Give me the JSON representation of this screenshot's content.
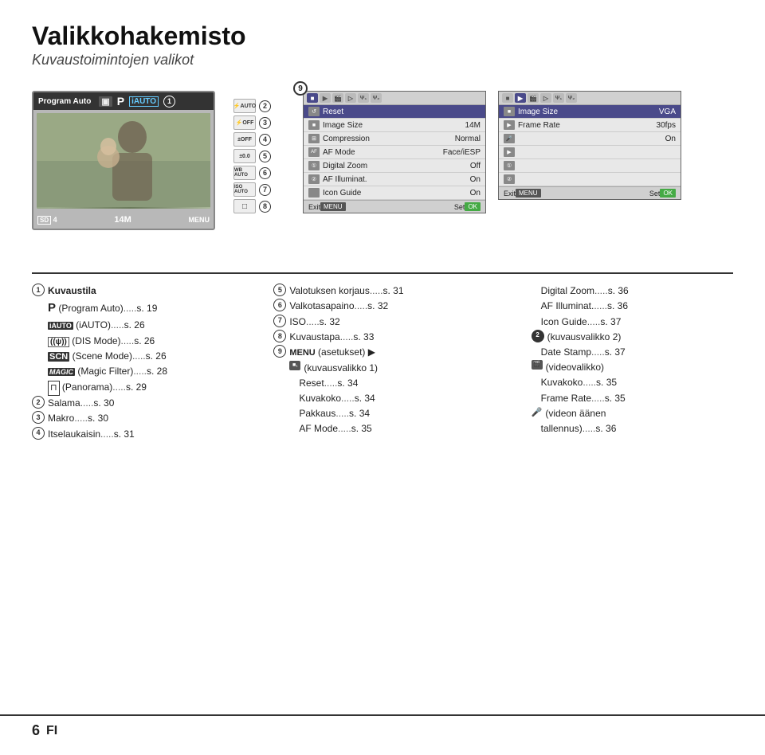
{
  "header": {
    "title": "Valikkohakemisto",
    "subtitle": "Kuvaustoimintojen valikot"
  },
  "camera": {
    "mode_label": "Program Auto",
    "p_label": "P",
    "iauto_label": "iAUTO",
    "badge_1": "1",
    "bottom_left": "4",
    "bottom_mid": "14M",
    "menu_label": "MENU"
  },
  "side_items": [
    {
      "icon": "⚡AUTO",
      "num": "2"
    },
    {
      "icon": "⚡OFF",
      "num": "3"
    },
    {
      "icon": "±OFF",
      "num": "4"
    },
    {
      "icon": "±0.0",
      "num": "5"
    },
    {
      "icon": "WB AUTO",
      "num": "6"
    },
    {
      "icon": "ISO AUTO",
      "num": "7"
    },
    {
      "icon": "□",
      "num": "8"
    }
  ],
  "menu_panel_left": {
    "badge": "9",
    "tabs": [
      "cam1",
      "cam2",
      "vid",
      "play",
      "tab1",
      "tab2"
    ],
    "rows": [
      {
        "icon": "↺",
        "label": "Reset",
        "value": ""
      },
      {
        "icon": "■",
        "label": "Image Size",
        "value": "14M"
      },
      {
        "icon": "⊞",
        "label": "Compression",
        "value": "Normal"
      },
      {
        "icon": "AF",
        "label": "AF Mode",
        "value": "Face/iESP"
      },
      {
        "icon": "①",
        "label": "Digital Zoom",
        "value": "Off"
      },
      {
        "icon": "②",
        "label": "AF Illuminat.",
        "value": "On"
      },
      {
        "icon": "",
        "label": "Icon Guide",
        "value": "On"
      }
    ],
    "footer_exit": "Exit",
    "footer_menu": "MENU",
    "footer_set": "Set",
    "footer_ok": "OK"
  },
  "menu_panel_right": {
    "tabs": [
      "cam1",
      "cam2",
      "vid",
      "play",
      "tab1",
      "tab2"
    ],
    "rows": [
      {
        "icon": "■",
        "label": "Image Size",
        "value": "VGA"
      },
      {
        "icon": "▶",
        "label": "Frame Rate",
        "value": "30fps"
      },
      {
        "icon": "🎤",
        "label": "",
        "value": "On"
      },
      {
        "icon": "▶",
        "label": "",
        "value": ""
      },
      {
        "icon": "①",
        "label": "",
        "value": ""
      },
      {
        "icon": "②",
        "label": "",
        "value": ""
      }
    ],
    "footer_exit": "Exit",
    "footer_menu": "MENU",
    "footer_set": "Set",
    "footer_ok": "OK"
  },
  "content": {
    "col1": {
      "heading": "Kuvaustila",
      "items": [
        {
          "num": "①",
          "text": "Kuvaustila"
        },
        {
          "num": "",
          "text": "P (Program Auto)...s. 19"
        },
        {
          "num": "",
          "text": "iAUTO (iAUTO)...s. 26"
        },
        {
          "num": "",
          "text": "(DIS Mode)...s. 26"
        },
        {
          "num": "",
          "text": "SCN (Scene Mode)...s. 26"
        },
        {
          "num": "",
          "text": "MAGIC (Magic Filter)...s. 28"
        },
        {
          "num": "",
          "text": "(Panorama)...s. 29"
        },
        {
          "num": "②",
          "text": "Salama...s. 30"
        },
        {
          "num": "③",
          "text": "Makro...s. 30"
        },
        {
          "num": "④",
          "text": "Itselaukaisin...s. 31"
        }
      ]
    },
    "col2": {
      "items": [
        {
          "num": "⑤",
          "text": "Valotuksen korjaus...s. 31"
        },
        {
          "num": "⑥",
          "text": "Valkotasapaino...s. 32"
        },
        {
          "num": "⑦",
          "text": "ISO...s. 32"
        },
        {
          "num": "⑧",
          "text": "Kuvaustapa...s. 33"
        },
        {
          "num": "⑨",
          "text": "MENU (asetukset) ▶"
        },
        {
          "num": "",
          "text": "  (kuvausvalikko 1)"
        },
        {
          "num": "",
          "text": "  Reset...s. 34"
        },
        {
          "num": "",
          "text": "  Kuvakoko...s. 34"
        },
        {
          "num": "",
          "text": "  Pakkaus...s. 34"
        },
        {
          "num": "",
          "text": "  AF Mode...s. 35"
        }
      ]
    },
    "col3": {
      "items": [
        {
          "num": "",
          "text": "Digital Zoom...s. 36"
        },
        {
          "num": "",
          "text": "AF Illuminat....s. 36"
        },
        {
          "num": "",
          "text": "Icon Guide...s. 37"
        },
        {
          "num": "②",
          "text": "(kuvausvalikko 2)"
        },
        {
          "num": "",
          "text": "  Date Stamp...s. 37"
        },
        {
          "num": "",
          "text": "(videovalikko)"
        },
        {
          "num": "",
          "text": "  Kuvakoko...s. 35"
        },
        {
          "num": "",
          "text": "  Frame Rate...s. 35"
        },
        {
          "num": "",
          "text": "(videon äänen"
        },
        {
          "num": "",
          "text": "  tallennus)...s. 36"
        }
      ]
    }
  },
  "footer": {
    "page_num": "6",
    "lang": "FI"
  }
}
